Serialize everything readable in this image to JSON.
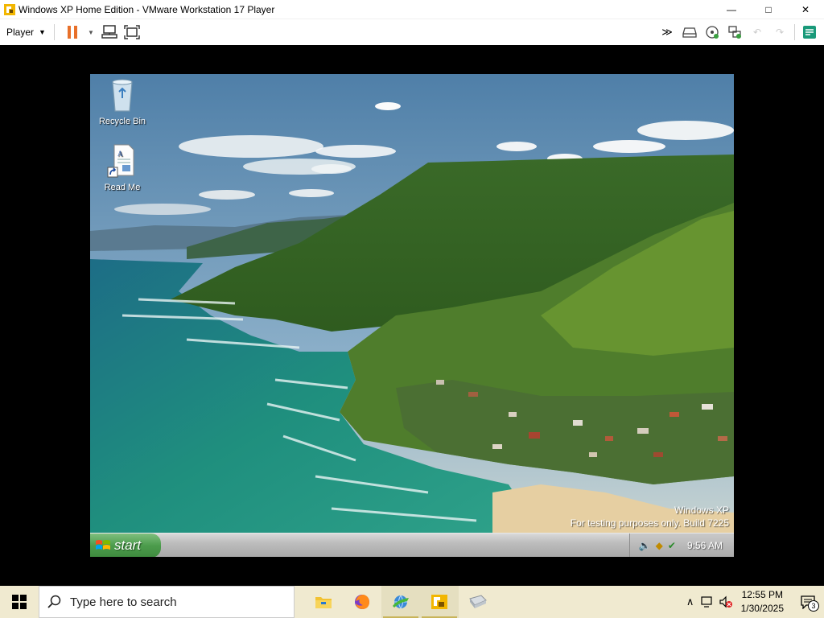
{
  "window": {
    "title": "Windows XP Home Edition - VMware Workstation 17 Player",
    "minimize_glyph": "—",
    "maximize_glyph": "□",
    "close_glyph": "✕"
  },
  "toolbar": {
    "player_label": "Player",
    "right_icons": [
      "send-ctrl-alt-del-icon",
      "removable-devices-icon",
      "cd-drive-icon",
      "network-icon",
      "back-icon",
      "forward-icon",
      "unity-icon"
    ]
  },
  "vm": {
    "desktop_icons": [
      {
        "label": "Recycle Bin",
        "icon": "recycle-bin-icon"
      },
      {
        "label": "Read Me",
        "icon": "document-shortcut-icon"
      }
    ],
    "watermark_line1": "Windows XP",
    "watermark_line2": "For testing purposes only. Build 7225",
    "start_label": "start",
    "clock": "9:56 AM"
  },
  "host_taskbar": {
    "search_placeholder": "Type here to search",
    "apps": [
      "file-explorer-icon",
      "firefox-icon",
      "network-app-icon",
      "vmware-player-icon",
      "disk-image-icon"
    ],
    "time": "12:55 PM",
    "date": "1/30/2025",
    "notification_count": "3"
  },
  "colors": {
    "host_taskbar": "#f0ead0",
    "xp_start": "#4c9c4c",
    "pause_orange": "#e8702a",
    "vm_background": "#000000"
  }
}
